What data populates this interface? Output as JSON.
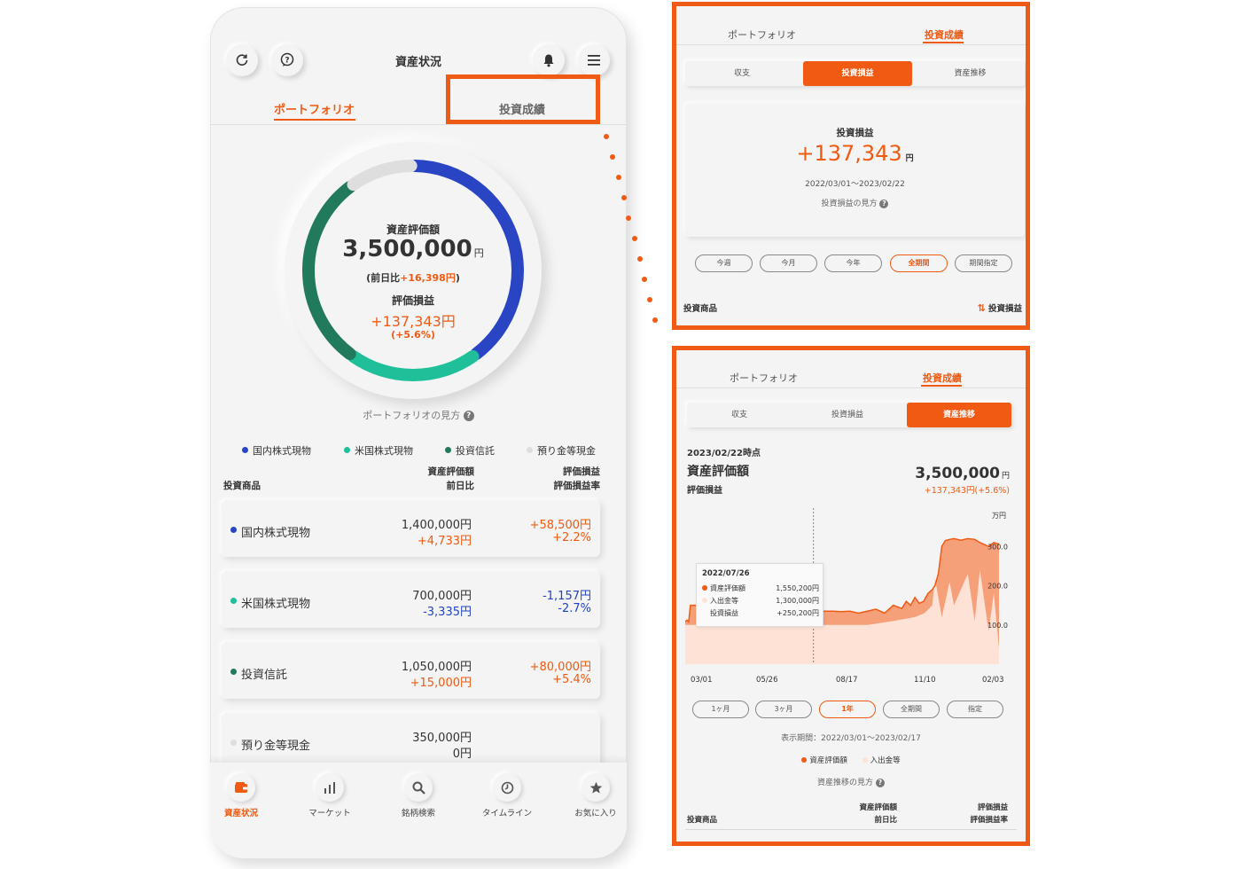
{
  "phone": {
    "header": {
      "title": "資産状況"
    },
    "tabs": {
      "portfolio": "ポートフォリオ",
      "performance": "投資成績"
    },
    "donut": {
      "total_label": "資産評価額",
      "total_value": "3,500,000",
      "total_unit": "円",
      "change_prefix": "(前日比",
      "change_value": "+16,398円",
      "change_suffix": ")",
      "pl_label": "評価損益",
      "pl_value": "+137,343円",
      "pl_rate": "(+5.6%)",
      "segments": [
        {
          "name": "国内株式現物",
          "value": 1400000,
          "color": "#2a45c4"
        },
        {
          "name": "米国株式現物",
          "value": 700000,
          "color": "#1fbf9a"
        },
        {
          "name": "投資信託",
          "value": 1050000,
          "color": "#227a5c"
        },
        {
          "name": "預り金等現金",
          "value": 350000,
          "color": "#dedede"
        }
      ]
    },
    "howto": "ポートフォリオの見方",
    "legend": [
      "国内株式現物",
      "米国株式現物",
      "投資信託",
      "預り金等現金"
    ],
    "table_header": {
      "product": "投資商品",
      "value": "資産評価額",
      "dod": "前日比",
      "pl": "評価損益",
      "pl_rate": "評価損益率"
    },
    "rows": [
      {
        "name": "国内株式現物",
        "value": "1,400,000円",
        "change": "+4,733円",
        "pl": "+58,500円",
        "rate": "+2.2%"
      },
      {
        "name": "米国株式現物",
        "value": "700,000円",
        "change": "-3,335円",
        "pl": "-1,157円",
        "rate": "-2.7%"
      },
      {
        "name": "投資信託",
        "value": "1,050,000円",
        "change": "+15,000円",
        "pl": "+80,000円",
        "rate": "+5.4%"
      },
      {
        "name": "預り金等現金",
        "value": "350,000円",
        "change": "0円",
        "pl": "",
        "rate": ""
      }
    ],
    "nav": [
      "資産状況",
      "マーケット",
      "銘柄検索",
      "タイムライン",
      "お気に入り"
    ]
  },
  "panel1": {
    "tabs": {
      "portfolio": "ポートフォリオ",
      "performance": "投資成績"
    },
    "segments": [
      "収支",
      "投資損益",
      "資産推移"
    ],
    "card": {
      "label": "投資損益",
      "value": "+137,343",
      "unit": "円",
      "period": "2022/03/01〜2023/02/22",
      "howto": "投資損益の見方"
    },
    "periods": [
      "今週",
      "今月",
      "今年",
      "全期間",
      "期間指定"
    ],
    "footer": {
      "left": "投資商品",
      "right": "投資損益"
    }
  },
  "panel2": {
    "tabs": {
      "portfolio": "ポートフォリオ",
      "performance": "投資成績"
    },
    "segments": [
      "収支",
      "投資損益",
      "資産推移"
    ],
    "asof": "2023/02/22時点",
    "total_label": "資産評価額",
    "total_value": "3,500,000",
    "total_unit": "円",
    "pl_label": "評価損益",
    "pl_value": "+137,343円(+5.6%)",
    "tooltip": {
      "date": "2022/07/26",
      "rows": [
        {
          "label": "資産評価額",
          "value": "1,550,200円"
        },
        {
          "label": "入出金等",
          "value": "1,300,000円"
        },
        {
          "label": "投資損益",
          "value": "+250,200円"
        }
      ]
    },
    "ranges": [
      "1ヶ月",
      "3ヶ月",
      "1年",
      "全期間",
      "指定"
    ],
    "display_period": "表示期間：2022/03/01〜2023/02/17",
    "legend": [
      "資産評価額",
      "入出金等"
    ],
    "howto": "資産推移の見方",
    "table_header": {
      "product": "投資商品",
      "value": "資産評価額",
      "dod": "前日比",
      "pl": "評価損益",
      "pl_rate": "評価損益率"
    }
  },
  "chart_data": {
    "type": "area",
    "y_unit": "万円",
    "x_tick_labels": [
      "03/01",
      "05/26",
      "08/17",
      "11/10",
      "02/03"
    ],
    "y_tick_labels": [
      "100.0",
      "200.0",
      "300.0"
    ],
    "ylim": [
      0,
      330
    ],
    "grid": false,
    "legend_position": "bottom",
    "series": [
      {
        "name": "資産評価額",
        "color": "#f47a45",
        "x": [
          0,
          2,
          4,
          6,
          12,
          20,
          30,
          40,
          50,
          60,
          70,
          80,
          90,
          100,
          110,
          120,
          130,
          140,
          148,
          156,
          158,
          160,
          170,
          180,
          190,
          200,
          210,
          220,
          230,
          240,
          250,
          255,
          260,
          265,
          270,
          275,
          280,
          285,
          288,
          292,
          296,
          300,
          305,
          310,
          318,
          326,
          334,
          340,
          350,
          356,
          362
        ],
        "y": [
          108,
          112,
          108,
          150,
          150,
          148,
          155,
          160,
          152,
          140,
          150,
          156,
          158,
          155,
          152,
          158,
          160,
          155,
          155,
          140,
          130,
          135,
          135,
          134,
          135,
          130,
          135,
          140,
          130,
          150,
          142,
          160,
          150,
          170,
          155,
          160,
          180,
          190,
          200,
          230,
          300,
          315,
          318,
          320,
          316,
          320,
          318,
          310,
          300,
          310,
          306
        ]
      },
      {
        "name": "入出金等",
        "color": "#fde2d5",
        "x": [
          0,
          12,
          60,
          148,
          156,
          210,
          240,
          265,
          276,
          285,
          288,
          296,
          305,
          310,
          326,
          334,
          340,
          350,
          356,
          362
        ],
        "y": [
          100,
          100,
          100,
          120,
          100,
          100,
          110,
          120,
          130,
          150,
          220,
          120,
          210,
          150,
          230,
          110,
          240,
          85,
          180,
          40
        ]
      }
    ]
  }
}
